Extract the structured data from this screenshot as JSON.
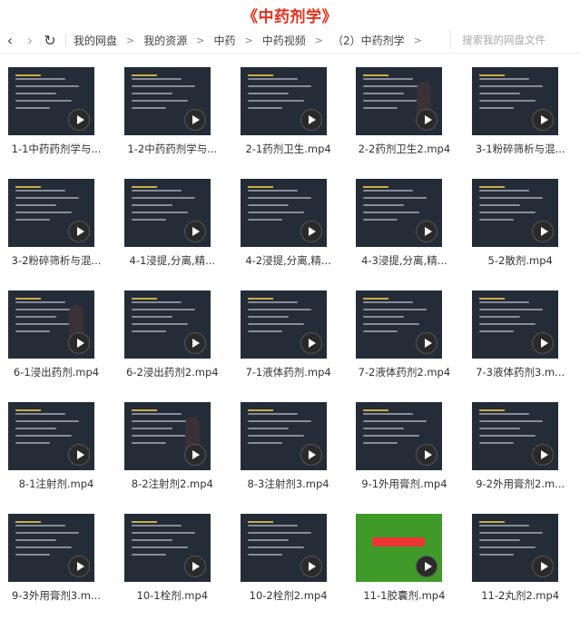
{
  "page_title": "《中药剂学》",
  "nav": {
    "back_icon": "back-arrow-icon",
    "forward_icon": "forward-arrow-icon",
    "refresh_icon": "refresh-icon",
    "breadcrumbs": [
      "我的网盘",
      "我的资源",
      "中药",
      "中药视频",
      "（2）中药剂学"
    ],
    "search_placeholder": "搜索我的网盘文件"
  },
  "files": [
    {
      "name": "1-1中药药剂学与..."
    },
    {
      "name": "1-2中药药剂学与..."
    },
    {
      "name": "2-1药剂卫生.mp4"
    },
    {
      "name": "2-2药剂卫生2.mp4"
    },
    {
      "name": "3-1粉碎筛析与混..."
    },
    {
      "name": "3-2粉碎筛析与混..."
    },
    {
      "name": "4-1浸提,分离,精..."
    },
    {
      "name": "4-2浸提,分离,精..."
    },
    {
      "name": "4-3浸提,分离,精..."
    },
    {
      "name": "5-2散剂.mp4"
    },
    {
      "name": "6-1浸出药剂.mp4"
    },
    {
      "name": "6-2浸出药剂2.mp4"
    },
    {
      "name": "7-1液体药剂.mp4"
    },
    {
      "name": "7-2液体药剂2.mp4"
    },
    {
      "name": "7-3液体药剂3.m..."
    },
    {
      "name": "8-1注射剂.mp4"
    },
    {
      "name": "8-2注射剂2.mp4"
    },
    {
      "name": "8-3注射剂3.mp4"
    },
    {
      "name": "9-1外用膏剂.mp4"
    },
    {
      "name": "9-2外用膏剂2.m..."
    },
    {
      "name": "9-3外用膏剂3.m..."
    },
    {
      "name": "10-1栓剂.mp4"
    },
    {
      "name": "10-2栓剂2.mp4"
    },
    {
      "name": "11-1胶囊剂.mp4"
    },
    {
      "name": "11-2丸剂2.mp4"
    }
  ],
  "colors": {
    "title": "#e8301c"
  }
}
